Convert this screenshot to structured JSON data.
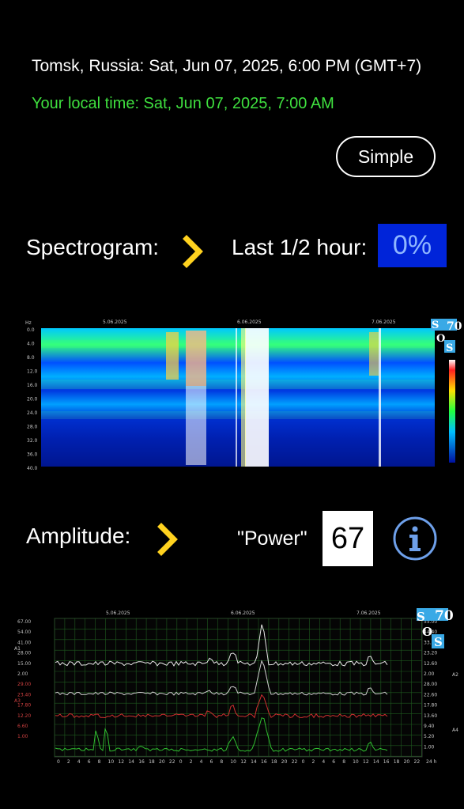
{
  "header": {
    "location_time": "Tomsk, Russia: Sat, Jun 07, 2025, 6:00 PM (GMT+7)",
    "local_time": "Your local time: Sat, Jun 07, 2025, 7:00 AM"
  },
  "buttons": {
    "simple": "Simple"
  },
  "spectrogram": {
    "label": "Spectrogram:",
    "last_label": "Last 1/2 hour:",
    "percent": "0%",
    "dates": [
      "5.06.2025",
      "6.06.2025",
      "7.06.2025"
    ],
    "y_unit": "Hz",
    "y_ticks": [
      "0.0",
      "4.0",
      "8.0",
      "12.0",
      "16.0",
      "20.0",
      "24.0",
      "28.0",
      "32.0",
      "36.0",
      "40.0"
    ]
  },
  "amplitude": {
    "label": "Amplitude:",
    "power_label": "\"Power\"",
    "power_value": "67",
    "dates": [
      "5.06.2025",
      "6.06.2025",
      "7.06.2025"
    ],
    "left_ticks": [
      "67.00",
      "54.00",
      "41.00",
      "28.00",
      "15.00",
      "2.00",
      "29.00",
      "23.40",
      "17.80",
      "12.20",
      "6.60",
      "1.00"
    ],
    "right_ticks": [
      "55.00",
      "44.40",
      "33.80",
      "23.20",
      "12.60",
      "2.00",
      "28.00",
      "22.60",
      "17.80",
      "13.60",
      "9.40",
      "5.20",
      "1.00"
    ],
    "series_labels": [
      "A1",
      "A2",
      "A3",
      "A4"
    ],
    "x_ticks": [
      "0",
      "2",
      "4",
      "6",
      "8",
      "10",
      "12",
      "14",
      "16",
      "18",
      "20",
      "22",
      "0",
      "2",
      "4",
      "6",
      "8",
      "10",
      "12",
      "14",
      "16",
      "18",
      "20",
      "22",
      "0",
      "2",
      "4",
      "6",
      "8",
      "10",
      "12",
      "14",
      "16",
      "18",
      "20",
      "22"
    ],
    "x_unit": "24 h"
  },
  "logo": {
    "number": "70",
    "letters": [
      "S",
      "O",
      "S"
    ]
  },
  "icons": {
    "chevron": "chevron-right-icon",
    "info": "info-icon"
  },
  "colors": {
    "accent_yellow": "#ffd21f",
    "local_time_green": "#3fe03f",
    "percent_box": "#0024d9",
    "logo_blue": "#39a9e6"
  }
}
